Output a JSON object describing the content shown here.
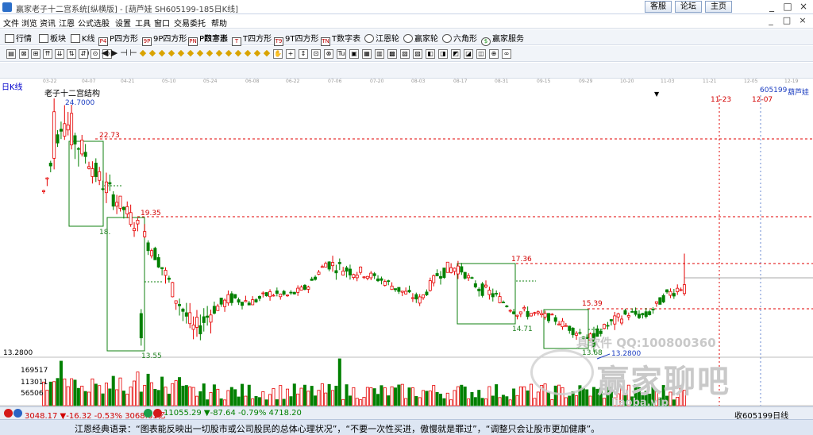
{
  "window": {
    "title": "赢家老子十二宫系统[纵横版] - [葫芦娃 SH605199-185日K线]",
    "buttons": [
      "客服",
      "论坛",
      "主页"
    ],
    "controls": [
      "_",
      "□",
      "×"
    ]
  },
  "menu": [
    "文件",
    "浏览",
    "资讯",
    "江恩",
    "公式选股",
    "设置",
    "工具",
    "窗口",
    "交易委托",
    "帮助"
  ],
  "toolbar1": [
    {
      "label": "行情",
      "icon": "grid-icon"
    },
    {
      "label": "板块",
      "icon": "sector-icon"
    },
    {
      "label": "K线",
      "icon": "kline-icon"
    },
    {
      "label": "P四方形",
      "icon": "p-square-icon",
      "badge": "P4"
    },
    {
      "label": "9P四方形",
      "icon": "9p-square-icon",
      "badge": "9P"
    },
    {
      "label": "P四方形",
      "icon": "p-square2-icon",
      "badge": "P9"
    },
    {
      "label": "P数字表",
      "icon": "p-number-table-icon",
      "badge": "PN"
    },
    {
      "label": "T四方形",
      "icon": "t-square-icon",
      "badge": "T"
    },
    {
      "label": "9T四方形",
      "icon": "9t-square-icon",
      "badge": "T9"
    },
    {
      "label": "T数字表",
      "icon": "t-number-table-icon",
      "badge": "TN"
    },
    {
      "label": "江恩轮",
      "icon": "gann-wheel-icon"
    },
    {
      "label": "赢家轮",
      "icon": "winner-wheel-icon"
    },
    {
      "label": "六角形",
      "icon": "hexagon-icon"
    },
    {
      "label": "赢家服务",
      "icon": "dollar-icon",
      "badge": "$"
    }
  ],
  "toolbar2": {
    "zero": "0"
  },
  "dates": [
    "03-22",
    "04-07",
    "04-21",
    "05-10",
    "05-24",
    "06-08",
    "06-22",
    "07-06",
    "07-20",
    "08-03",
    "08-17",
    "08-31",
    "09-15",
    "09-29",
    "10-20",
    "11-03",
    "11-21",
    "12-05",
    "12-19"
  ],
  "chart": {
    "period_label": "日K线",
    "study_title": "老子十二宫结构",
    "code": "605199",
    "name": "葫芦娃",
    "future_dates": [
      "11-23",
      "12-07"
    ],
    "price_labels": [
      {
        "text": "24.7000",
        "color": "#1a3cc0"
      },
      {
        "text": "22.73",
        "color": "#d20000"
      },
      {
        "text": "19.35",
        "color": "#d20000"
      },
      {
        "text": "18.",
        "color": "#208020"
      },
      {
        "text": "13.55",
        "color": "#208020"
      },
      {
        "text": "17.36",
        "color": "#d20000"
      },
      {
        "text": "14.71",
        "color": "#208020"
      },
      {
        "text": "15.39",
        "color": "#d20000"
      },
      {
        "text": "13.68",
        "color": "#208020"
      },
      {
        "text": "13.2800",
        "color": "#1a3cc0"
      }
    ],
    "price_axis_low": "13.2800",
    "volume_labels": [
      "169517",
      "113011",
      "56506"
    ],
    "colors": {
      "up": "#e60000",
      "down": "#008000",
      "box": "#108010",
      "ref_line": "#e00000"
    }
  },
  "chart_data": {
    "type": "candlestick",
    "title": "老子十二宫结构",
    "series": [
      {
        "name": "葫芦娃 605199 日K线",
        "ohlc_path": [
          [
            0,
            19.5,
            20.8,
            19.0,
            20.5
          ],
          [
            1,
            20.5,
            24.7,
            20.0,
            23.8
          ],
          [
            2,
            23.8,
            24.5,
            22.0,
            22.5
          ],
          [
            3,
            22.5,
            23.0,
            20.5,
            21.0
          ],
          [
            4,
            21.0,
            21.6,
            19.6,
            20.0
          ],
          [
            5,
            20.0,
            20.4,
            18.4,
            18.9
          ],
          [
            6,
            18.9,
            19.2,
            17.2,
            17.6
          ],
          [
            7,
            17.6,
            18.0,
            15.5,
            15.8
          ],
          [
            8,
            15.8,
            16.2,
            13.55,
            14.2
          ],
          [
            9,
            14.2,
            15.4,
            13.9,
            15.2
          ],
          [
            10,
            15.2,
            16.0,
            14.9,
            15.7
          ],
          [
            11,
            15.7,
            16.0,
            15.2,
            15.5
          ],
          [
            12,
            15.5,
            16.1,
            15.3,
            15.9
          ],
          [
            13,
            15.9,
            16.3,
            15.6,
            15.8
          ],
          [
            14,
            15.8,
            16.4,
            15.7,
            16.2
          ],
          [
            15,
            16.2,
            17.5,
            16.0,
            17.3
          ],
          [
            16,
            17.3,
            18.2,
            16.8,
            17.0
          ],
          [
            17,
            17.0,
            17.4,
            16.5,
            16.8
          ],
          [
            18,
            16.8,
            17.2,
            16.2,
            16.5
          ],
          [
            19,
            16.5,
            16.8,
            15.8,
            16.0
          ],
          [
            20,
            16.0,
            16.4,
            15.4,
            15.6
          ],
          [
            21,
            15.6,
            17.0,
            15.4,
            16.9
          ],
          [
            22,
            16.9,
            17.4,
            16.6,
            17.1
          ],
          [
            23,
            17.1,
            17.3,
            16.0,
            16.2
          ],
          [
            24,
            16.2,
            16.4,
            15.6,
            15.8
          ],
          [
            25,
            15.8,
            16.0,
            14.9,
            15.1
          ],
          [
            26,
            15.1,
            15.4,
            14.71,
            15.0
          ],
          [
            27,
            15.0,
            15.3,
            14.6,
            14.8
          ],
          [
            28,
            14.8,
            15.0,
            14.0,
            14.3
          ],
          [
            29,
            14.3,
            14.5,
            13.68,
            13.9
          ],
          [
            30,
            13.9,
            14.6,
            13.28,
            14.5
          ],
          [
            31,
            14.5,
            15.2,
            14.3,
            15.0
          ],
          [
            32,
            15.0,
            15.5,
            14.7,
            14.9
          ],
          [
            33,
            14.9,
            16.0,
            14.8,
            15.8
          ],
          [
            34,
            15.8,
            17.7,
            15.6,
            16.3
          ]
        ]
      }
    ],
    "levels": {
      "high": 24.7,
      "low": 13.28,
      "resistance": [
        22.73,
        19.35,
        17.36,
        15.39
      ],
      "support": [
        18.0,
        13.55,
        14.71,
        13.68
      ]
    },
    "volume_axis": [
      56506,
      113011,
      169517
    ]
  },
  "status": {
    "sh_index": "3048.17 ▼-16.32 -0.53% 3068.61亿",
    "sz_index": "11055.29 ▼-87.64 -0.79% 4718.20",
    "right": "收605199日线"
  },
  "quote": "江恩经典语录：“图表能反映出一切股市或公司股民的总体心理状况”，“不要一次性买进，傲慢就是罪过”，“调整只会让股市更加健康”。",
  "watermark": {
    "line1": "具软件   QQ:100800360",
    "line2": "赢家聊吧",
    "line3": "liaoba.vip"
  }
}
